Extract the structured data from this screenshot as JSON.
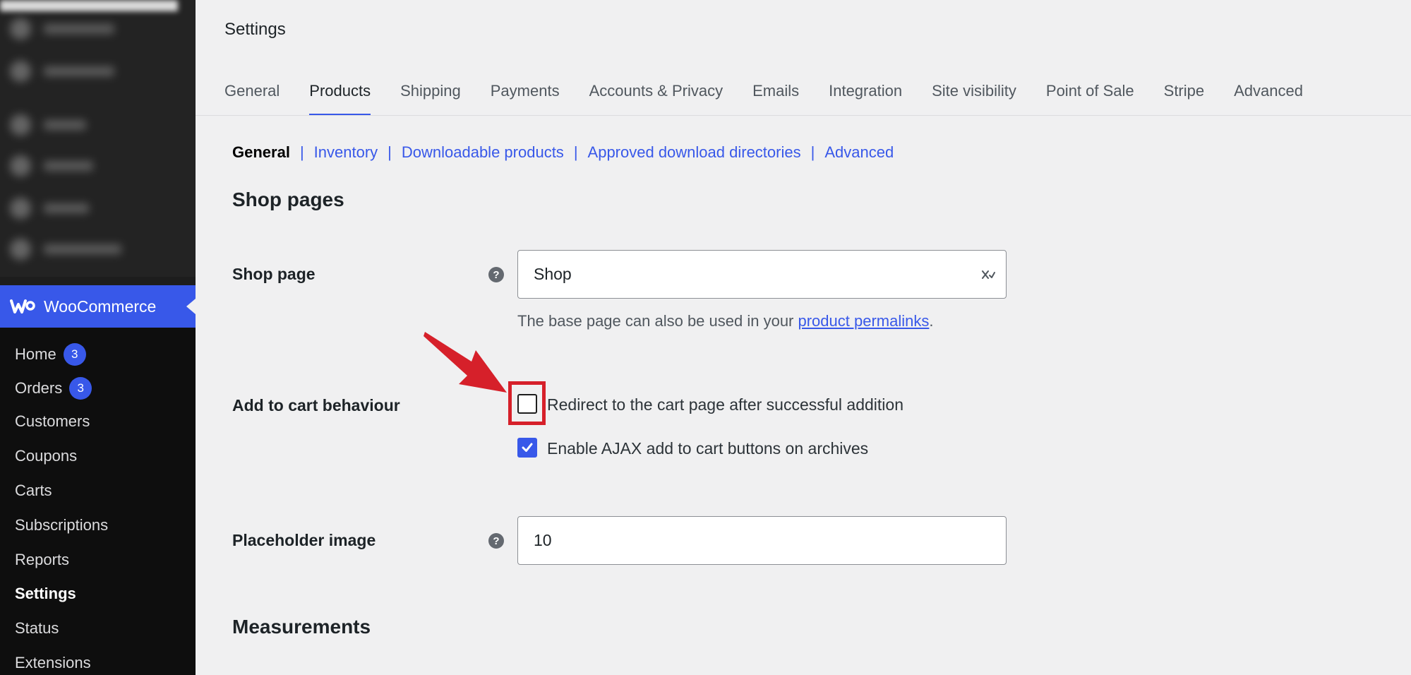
{
  "sidebar": {
    "brand_label": "WooCommerce",
    "items": [
      {
        "label": "Home",
        "badge": "3"
      },
      {
        "label": "Orders",
        "badge": "3"
      },
      {
        "label": "Customers"
      },
      {
        "label": "Coupons"
      },
      {
        "label": "Carts"
      },
      {
        "label": "Subscriptions"
      },
      {
        "label": "Reports"
      },
      {
        "label": "Settings",
        "active": true
      },
      {
        "label": "Status"
      },
      {
        "label": "Extensions"
      }
    ]
  },
  "page": {
    "title": "Settings"
  },
  "tabs": [
    "General",
    "Products",
    "Shipping",
    "Payments",
    "Accounts & Privacy",
    "Emails",
    "Integration",
    "Site visibility",
    "Point of Sale",
    "Stripe",
    "Advanced"
  ],
  "active_tab": "Products",
  "subnav": {
    "current": "General",
    "links": [
      "Inventory",
      "Downloadable products",
      "Approved download directories",
      "Advanced"
    ],
    "separator": "|"
  },
  "sections": {
    "shop_pages": "Shop pages",
    "measurements": "Measurements"
  },
  "fields": {
    "shop_page": {
      "label": "Shop page",
      "value": "Shop",
      "description_prefix": "The base page can also be used in your ",
      "description_link": "product permalinks",
      "description_suffix": "."
    },
    "add_to_cart": {
      "label": "Add to cart behaviour",
      "options": [
        {
          "label": "Redirect to the cart page after successful addition",
          "checked": false
        },
        {
          "label": "Enable AJAX add to cart buttons on archives",
          "checked": true
        }
      ]
    },
    "placeholder_image": {
      "label": "Placeholder image",
      "value": "10"
    }
  },
  "help_icon_glyph": "?",
  "colors": {
    "accent": "#3858e9",
    "sidebar_bg": "#0e0e0e",
    "highlight": "#d6202a"
  }
}
